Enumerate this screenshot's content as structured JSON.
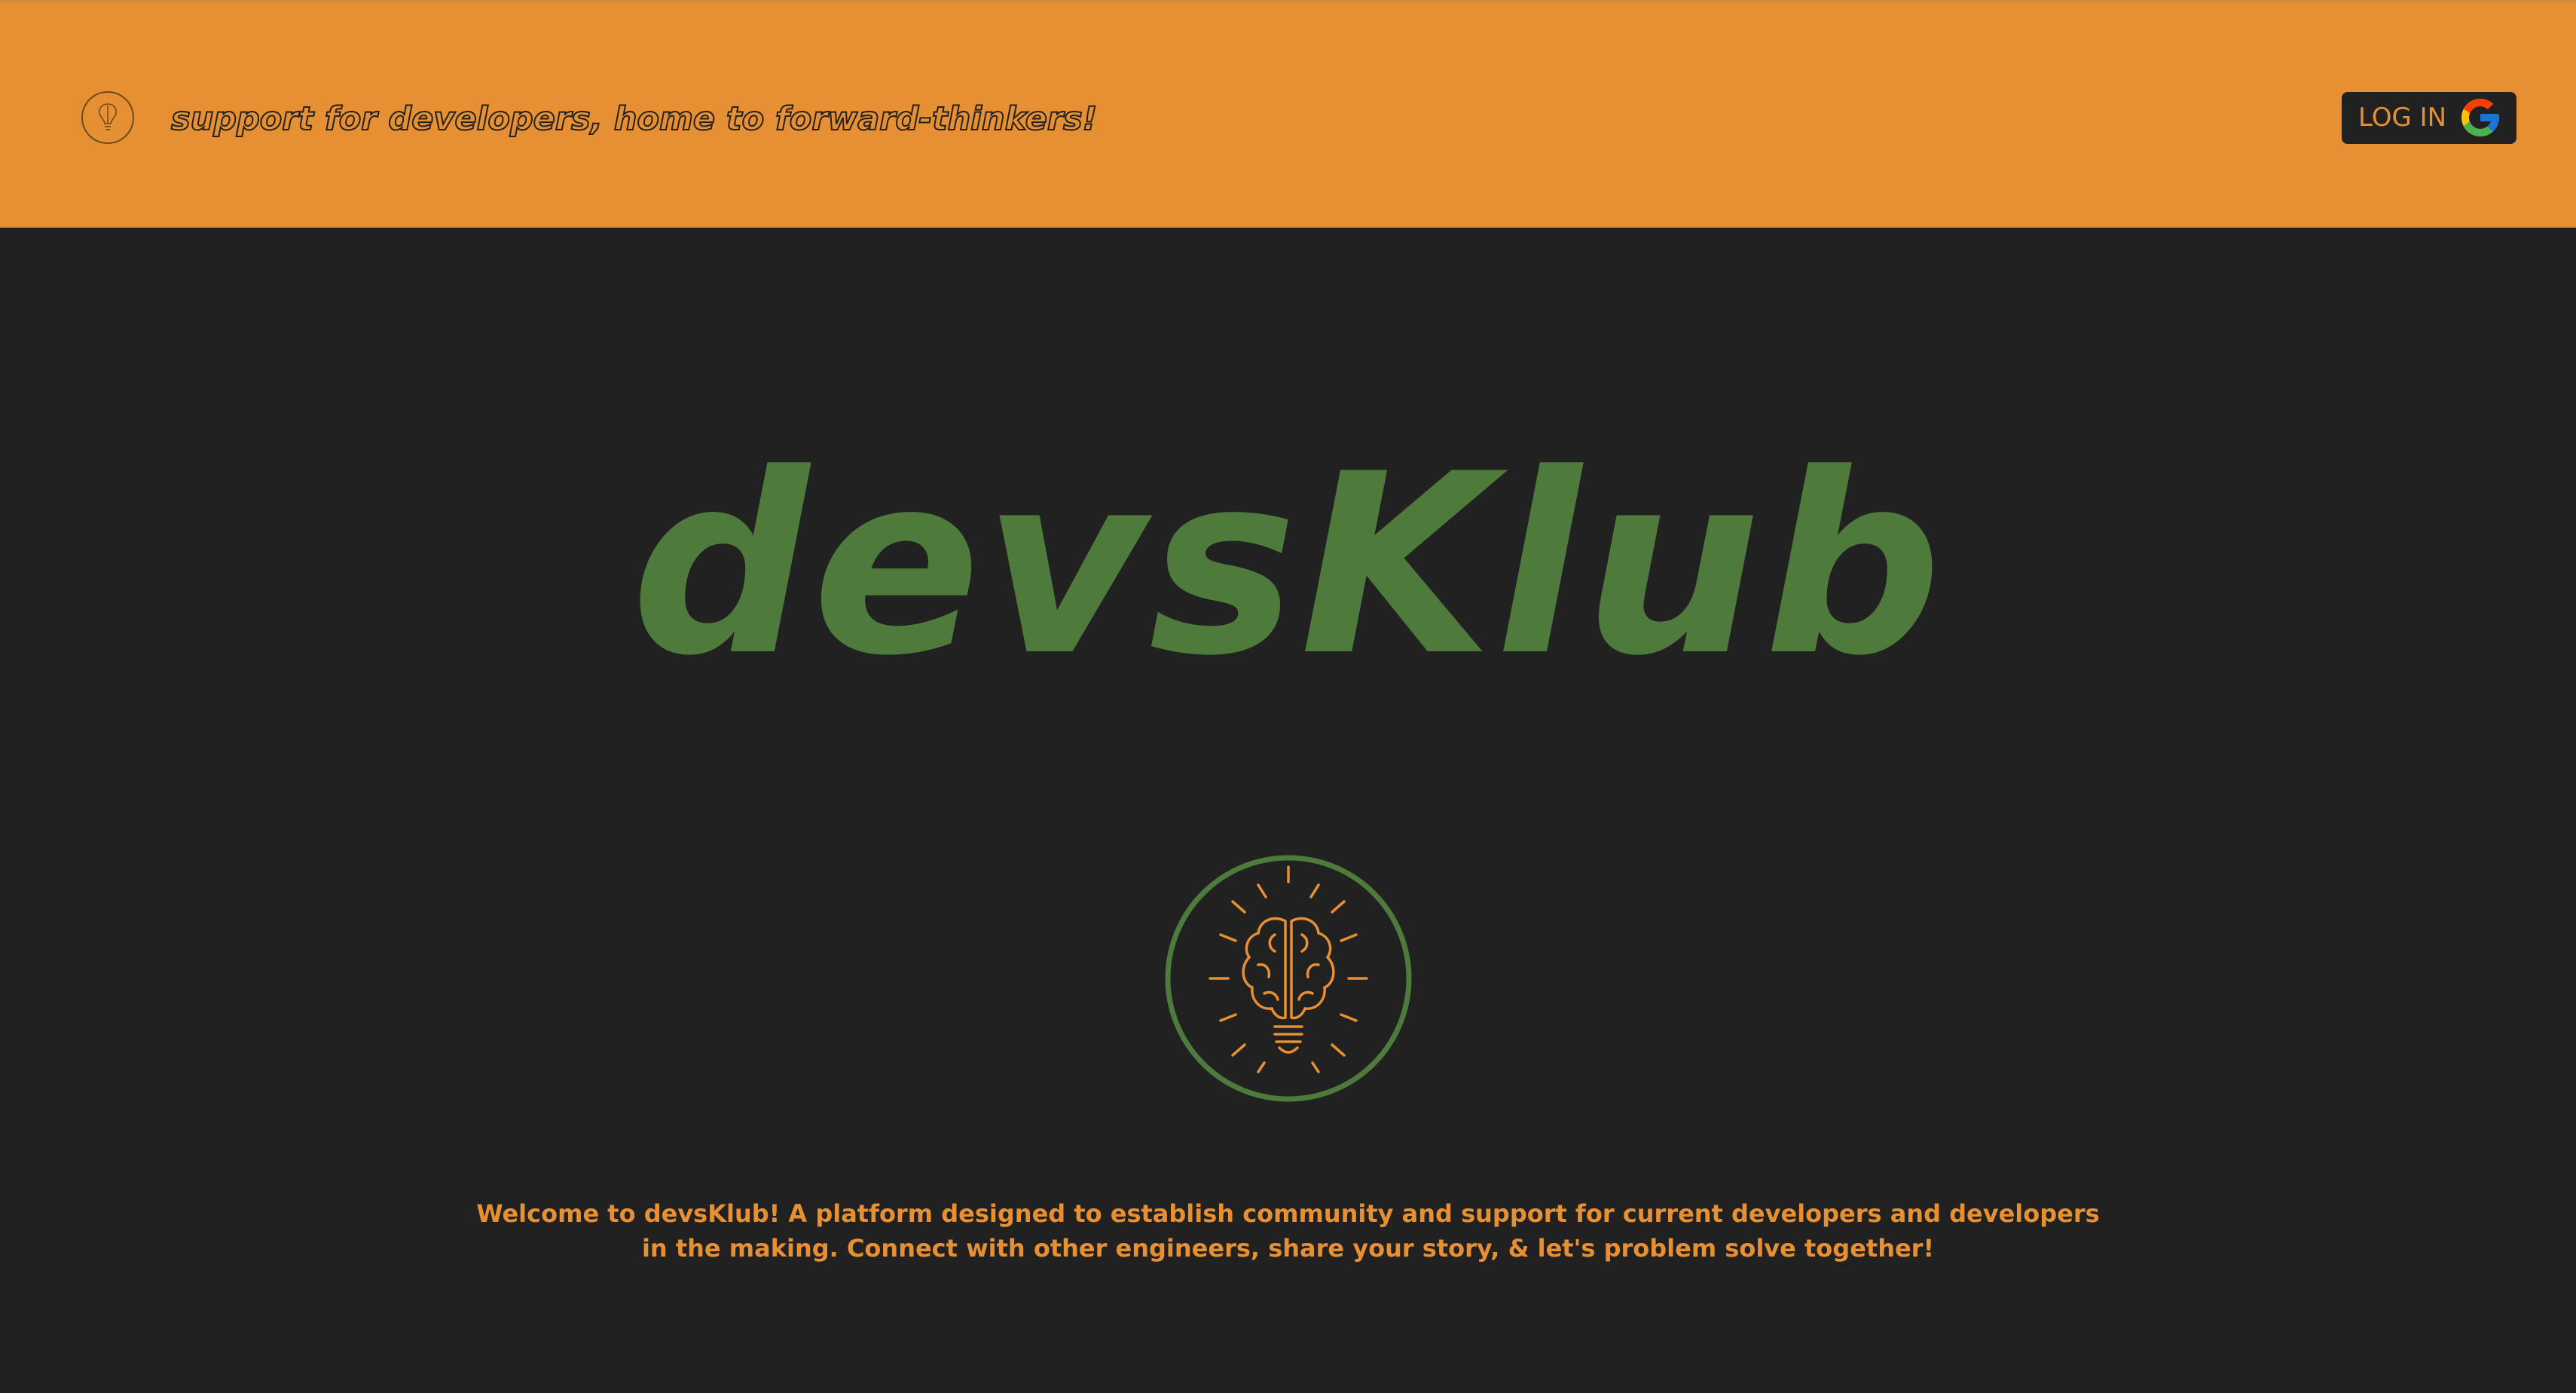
{
  "header": {
    "tagline": "support for developers, home to forward-thinkers!",
    "login_label": "LOG IN",
    "background_color": "#e69033"
  },
  "hero": {
    "title": "devsKlub",
    "title_color": "#4e7a3b",
    "icon": "brain-lightbulb-icon"
  },
  "welcome": {
    "line1": "Welcome to devsKlub! A platform designed to establish community and support for current developers and developers",
    "line2": "in the making. Connect with other engineers, share your story, & let's problem solve together!",
    "text_color": "#e69033"
  },
  "colors": {
    "page_background": "#212121",
    "accent_orange": "#e69033",
    "accent_green": "#4e7a3b"
  }
}
